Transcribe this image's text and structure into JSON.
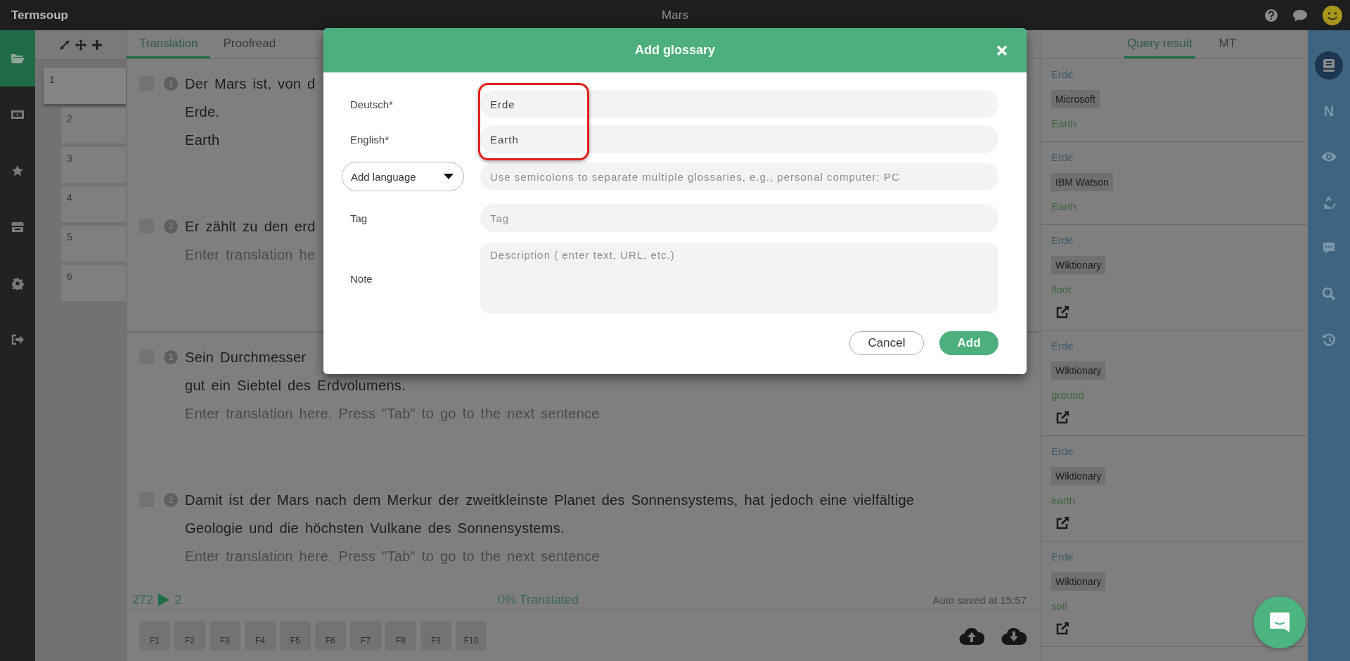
{
  "app": {
    "name": "Termsoup",
    "document_title": "Mars"
  },
  "left_rail": [
    {
      "kind": "folder",
      "selected": true
    },
    {
      "kind": "media",
      "selected": false
    },
    {
      "kind": "star",
      "selected": false
    },
    {
      "kind": "store",
      "selected": false
    },
    {
      "kind": "gear",
      "selected": false
    },
    {
      "kind": "logout",
      "selected": false
    }
  ],
  "segment_list": [
    {
      "number": "1",
      "selected": true
    },
    {
      "number": "2",
      "selected": false
    },
    {
      "number": "3",
      "selected": false
    },
    {
      "number": "4",
      "selected": false
    },
    {
      "number": "5",
      "selected": false
    },
    {
      "number": "6",
      "selected": false
    }
  ],
  "editor_tabs": [
    {
      "label": "Translation",
      "selected": true
    },
    {
      "label": "Proofread",
      "selected": false
    }
  ],
  "panes": [
    {
      "segments": [
        {
          "number": "1",
          "checked": false,
          "source_lines": [
            "Der Mars ist, von d",
            "Erde."
          ],
          "translation": "Earth"
        },
        {
          "number": "2",
          "checked": false,
          "source_lines": [
            "Er zählt zu den erd"
          ],
          "placeholder": "Enter translation he"
        }
      ]
    },
    {
      "segments": [
        {
          "number": "1",
          "checked": false,
          "source_lines": [
            "Sein Durchmesser",
            "gut ein Siebtel des Erdvolumens."
          ],
          "placeholder": "Enter translation here. Press \"Tab\" to go to the next sentence"
        },
        {
          "number": "2",
          "checked": false,
          "source_lines": [
            "Damit ist der Mars nach dem Merkur der zweitkleinste Planet des Sonnensystems, hat jedoch eine vielfältige",
            "Geologie und die höchsten Vulkane des Sonnensystems."
          ],
          "placeholder": "Enter translation here. Press \"Tab\" to go to the next sentence"
        }
      ]
    }
  ],
  "status": {
    "total": "272",
    "current": "2",
    "progress": "0% Translated",
    "saved": "Auto saved at 15:57"
  },
  "function_keys": [
    "F1",
    "F2",
    "F3",
    "F4",
    "F5",
    "F6",
    "F7",
    "F8",
    "F9",
    "F10"
  ],
  "glossary_dialog": {
    "title": "Add glossary",
    "fields": [
      {
        "kind": "text",
        "label": "Deutsch*",
        "value": "Erde",
        "highlighted": true
      },
      {
        "kind": "text",
        "label": "English*",
        "value": "Earth",
        "highlighted": true
      },
      {
        "kind": "language",
        "dropdown": "Add language",
        "placeholder": "Use semicolons to separate multiple glossaries, e.g., personal computer; PC"
      },
      {
        "kind": "text",
        "label": "Tag",
        "placeholder": "Tag"
      },
      {
        "kind": "multiline",
        "label": "Note",
        "placeholder": "Description ( enter text, URL, etc.)"
      }
    ],
    "buttons": [
      {
        "kind": "secondary",
        "label": "Cancel"
      },
      {
        "kind": "primary",
        "label": "Add"
      }
    ]
  },
  "side_tabs": [
    {
      "label": "Query result",
      "selected": true
    },
    {
      "label": "MT",
      "selected": false
    }
  ],
  "query_results": [
    {
      "term": "Erde",
      "source": "Microsoft",
      "translation": "Earth",
      "link": false
    },
    {
      "term": "Erde",
      "source": "IBM Watson",
      "translation": "Earth",
      "link": false
    },
    {
      "term": "Erde",
      "source": "Wiktionary",
      "translation": "floor",
      "link": true
    },
    {
      "term": "Erde",
      "source": "Wiktionary",
      "translation": "ground",
      "link": true
    },
    {
      "term": "Erde",
      "source": "Wiktionary",
      "translation": "earth",
      "link": true
    },
    {
      "term": "Erde",
      "source": "Wiktionary",
      "translation": "soil",
      "link": true
    }
  ],
  "right_rail": [
    {
      "kind": "book",
      "selected": true
    },
    {
      "kind": "letter",
      "label": "N",
      "selected": false
    },
    {
      "kind": "eye",
      "selected": false
    },
    {
      "kind": "recycle",
      "selected": false
    },
    {
      "kind": "chat",
      "selected": false
    },
    {
      "kind": "search",
      "selected": false
    },
    {
      "kind": "history",
      "selected": false
    }
  ]
}
